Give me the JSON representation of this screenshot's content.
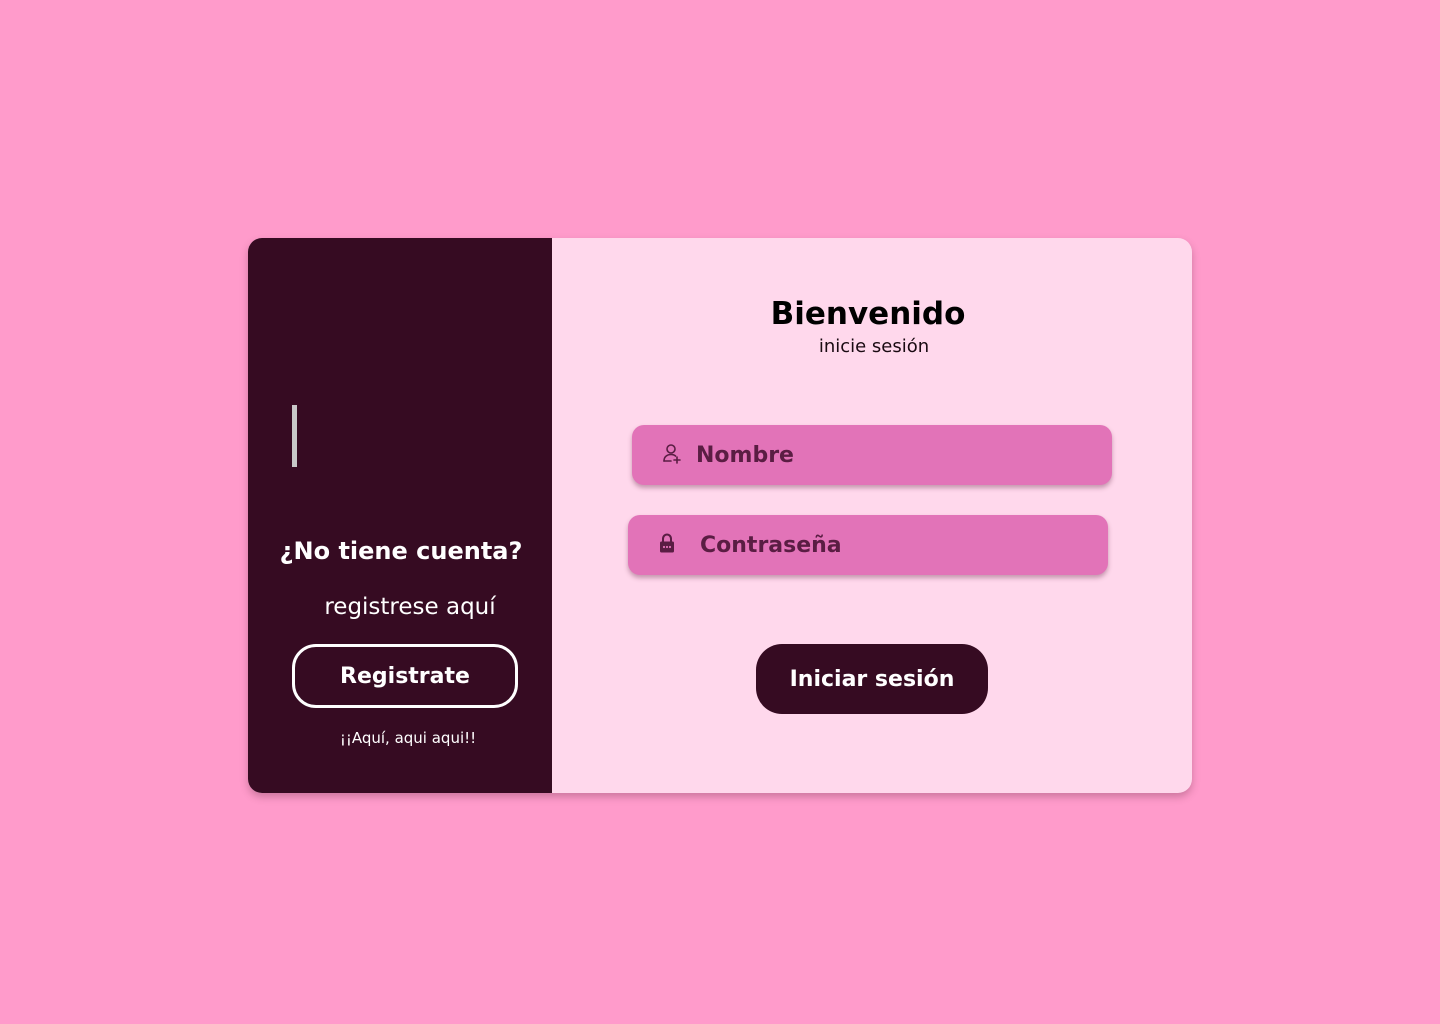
{
  "colors": {
    "background": "#ff9bcb",
    "panel_dark": "#360b22",
    "card_light": "#ffd8ec",
    "field_fill": "#e273b8",
    "field_text": "#5a1d43"
  },
  "register_panel": {
    "heading": "¿No tiene cuenta?",
    "subtext": "registrese aquí",
    "button_label": "Registrate",
    "footnote": "¡¡Aquí, aqui aqui!!"
  },
  "login_form": {
    "title": "Bienvenido",
    "subtitle": "inicie sesión",
    "fields": [
      {
        "icon": "user-icon",
        "placeholder": "Nombre",
        "value": ""
      },
      {
        "icon": "lock-icon",
        "placeholder": "Contraseña",
        "value": ""
      }
    ],
    "submit_label": "Iniciar sesión"
  }
}
